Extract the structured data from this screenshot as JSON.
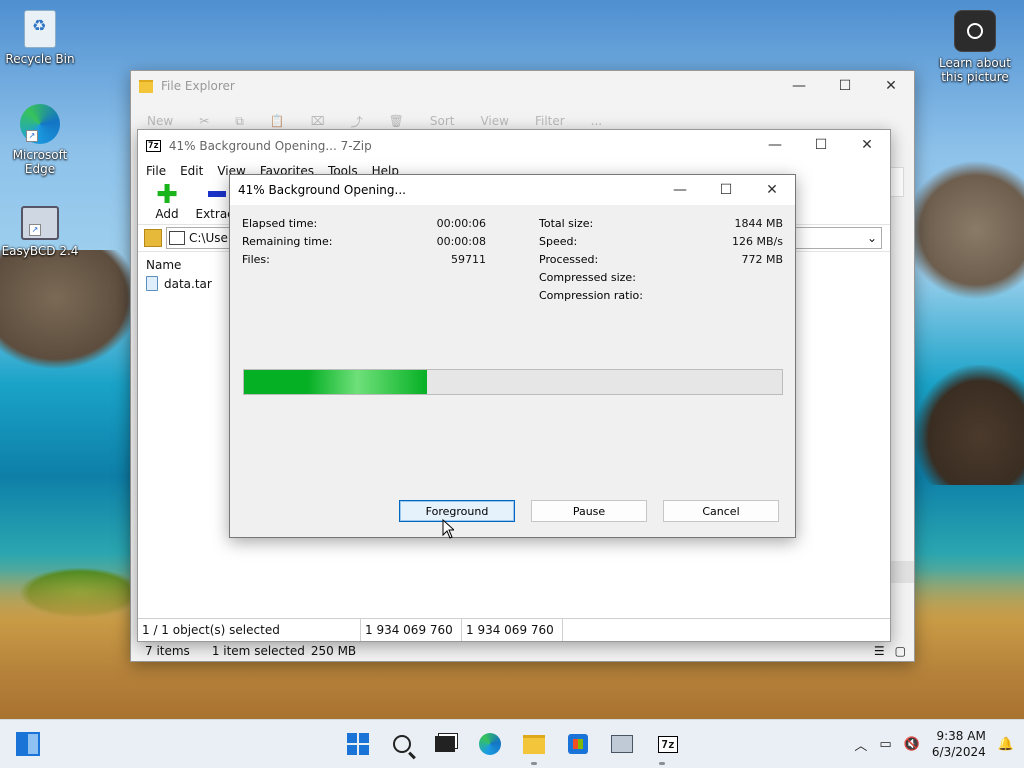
{
  "desktop": {
    "icons": [
      {
        "label": "Recycle Bin"
      },
      {
        "label": "Microsoft Edge"
      },
      {
        "label": "EasyBCD 2.4"
      },
      {
        "label": "Learn about this picture"
      }
    ]
  },
  "explorer": {
    "title": "File Explorer",
    "toolbar": [
      "New",
      "Sort",
      "View",
      "Filter",
      "..."
    ],
    "status": {
      "items": "7 items",
      "selected": "1 item selected",
      "size": "250 MB"
    }
  },
  "zip": {
    "title": "41% Background Opening... 7-Zip",
    "logo": "7z",
    "menu": [
      "File",
      "Edit",
      "View",
      "Favorites",
      "Tools",
      "Help"
    ],
    "toolbar": {
      "add": "Add",
      "extract": "Extract"
    },
    "address": "C:\\Use",
    "list_header": "Name",
    "files": [
      "data.tar"
    ],
    "status": {
      "selected": "1 / 1 object(s) selected",
      "size1": "1 934 069 760",
      "size2": "1 934 069 760"
    }
  },
  "dialog": {
    "title": "41% Background Opening...",
    "left_stats": [
      {
        "label": "Elapsed time:",
        "value": "00:00:06"
      },
      {
        "label": "Remaining time:",
        "value": "00:00:08"
      },
      {
        "label": "Files:",
        "value": "59711"
      }
    ],
    "right_stats": [
      {
        "label": "Total size:",
        "value": "1844 MB"
      },
      {
        "label": "Speed:",
        "value": "126 MB/s"
      },
      {
        "label": "Processed:",
        "value": "772 MB"
      },
      {
        "label": "Compressed size:",
        "value": ""
      },
      {
        "label": "Compression ratio:",
        "value": ""
      }
    ],
    "progress_fraction": 0.34,
    "buttons": {
      "foreground": "Foreground",
      "pause": "Pause",
      "cancel": "Cancel"
    }
  },
  "taskbar": {
    "time": "9:38 AM",
    "date": "6/3/2024",
    "z7": "7z"
  }
}
